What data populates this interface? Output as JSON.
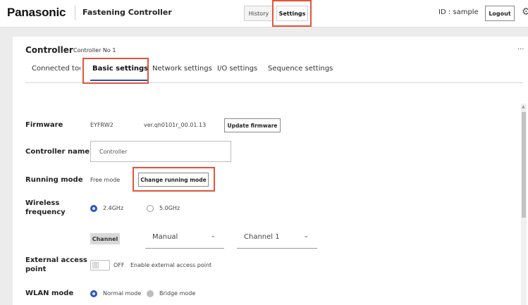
{
  "header": {
    "brand": "Panasonic",
    "app_title": "Fastening Controller",
    "history_label": "History",
    "settings_label": "Settings",
    "user_id": "ID : sample",
    "logout_label": "Logout",
    "settings_icon": "gear-icon"
  },
  "controller": {
    "title": "Controller",
    "subtitle": "Controller No 1",
    "more_label": "..."
  },
  "tabs": [
    {
      "label": "Connected tool",
      "active": false
    },
    {
      "label": "Basic settings",
      "active": true
    },
    {
      "label": "Network settings",
      "active": false
    },
    {
      "label": "I/O settings",
      "active": false
    },
    {
      "label": "Sequence settings",
      "active": false
    }
  ],
  "firmware": {
    "label": "Firmware",
    "name": "EYFRW2",
    "version": "ver.qh0101r_00.01.13",
    "update_label": "Update firmware"
  },
  "controller_name": {
    "label": "Controller name",
    "value": "Controller"
  },
  "running_mode": {
    "label": "Running mode",
    "value": "Free mode",
    "change_label": "Change running mode"
  },
  "wireless": {
    "label_line1": "Wireless",
    "label_line2": "frequency",
    "options": [
      {
        "label": "2.4GHz",
        "selected": true
      },
      {
        "label": "5.0GHz",
        "selected": false
      }
    ],
    "channel_label": "Channel",
    "channel_mode": "Manual",
    "channel_value": "Channel 1"
  },
  "external_access": {
    "label_line1": "External access",
    "label_line2": "point",
    "toggle_knob": "||",
    "state": "OFF",
    "description": "Enable external access point"
  },
  "wlan_mode": {
    "label": "WLAN mode",
    "options": [
      {
        "label": "Normal mode",
        "selected": true
      },
      {
        "label": "Bridge mode",
        "selected": false
      }
    ]
  },
  "colors": {
    "accent": "#2b56c7",
    "highlight": "#e0553a"
  }
}
